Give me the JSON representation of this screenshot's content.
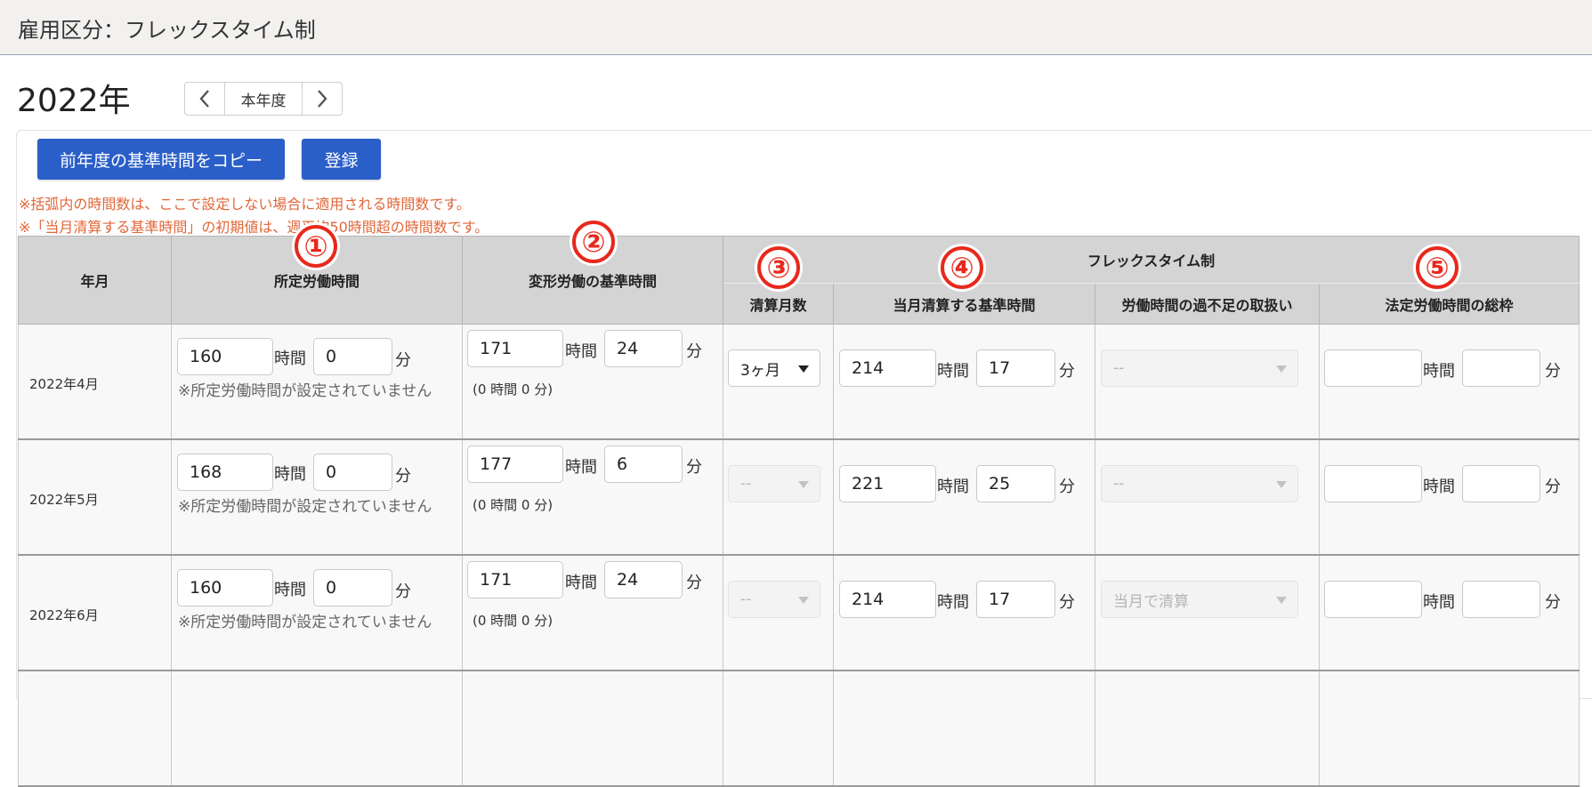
{
  "header": {
    "title": "雇用区分：フレックスタイム制"
  },
  "year_nav": {
    "year": "2022年",
    "prev_icon": "chevron-left-icon",
    "current_label": "本年度",
    "next_icon": "chevron-right-icon"
  },
  "actions": {
    "copy_label": "前年度の基準時間をコピー",
    "register_label": "登録"
  },
  "notes": [
    "※括弧内の時間数は、ここで設定しない場合に適用される時間数です。",
    "※「当月清算する基準時間」の初期値は、週平均50時間超の時間数です。"
  ],
  "table": {
    "col_yearmonth": "年月",
    "col_prescribed": "所定労働時間",
    "col_variable": "変形労働の基準時間",
    "group_flex": "フレックスタイム制",
    "col_months": "清算月数",
    "col_settle": "当月清算する基準時間",
    "col_excess": "労働時間の過不足の取扱い",
    "col_legal": "法定労働時間の総枠",
    "unit_hour": "時間",
    "unit_min": "分",
    "rows": [
      {
        "ym": "2022年4月",
        "p_h": "160",
        "p_m": "0",
        "p_note": "※所定労働時間が設定されていません",
        "v_h": "171",
        "v_m": "24",
        "v_note": "(0 時間 0 分)",
        "months": "3ヶ月",
        "months_enabled": true,
        "s_h": "214",
        "s_m": "17",
        "excess": "--",
        "l_h": "",
        "l_m": ""
      },
      {
        "ym": "2022年5月",
        "p_h": "168",
        "p_m": "0",
        "p_note": "※所定労働時間が設定されていません",
        "v_h": "177",
        "v_m": "6",
        "v_note": "(0 時間 0 分)",
        "months": "--",
        "months_enabled": false,
        "s_h": "221",
        "s_m": "25",
        "excess": "--",
        "l_h": "",
        "l_m": ""
      },
      {
        "ym": "2022年6月",
        "p_h": "160",
        "p_m": "0",
        "p_note": "※所定労働時間が設定されていません",
        "v_h": "171",
        "v_m": "24",
        "v_note": "(0 時間 0 分)",
        "months": "--",
        "months_enabled": false,
        "s_h": "214",
        "s_m": "17",
        "excess": "当月で清算",
        "l_h": "",
        "l_m": ""
      }
    ]
  },
  "badges": [
    "①",
    "②",
    "③",
    "④",
    "⑤"
  ],
  "colors": {
    "accent": "#2a5fc9",
    "note": "#e0673a",
    "badge": "#e8281c",
    "header_bg": "#d3d4d3"
  }
}
